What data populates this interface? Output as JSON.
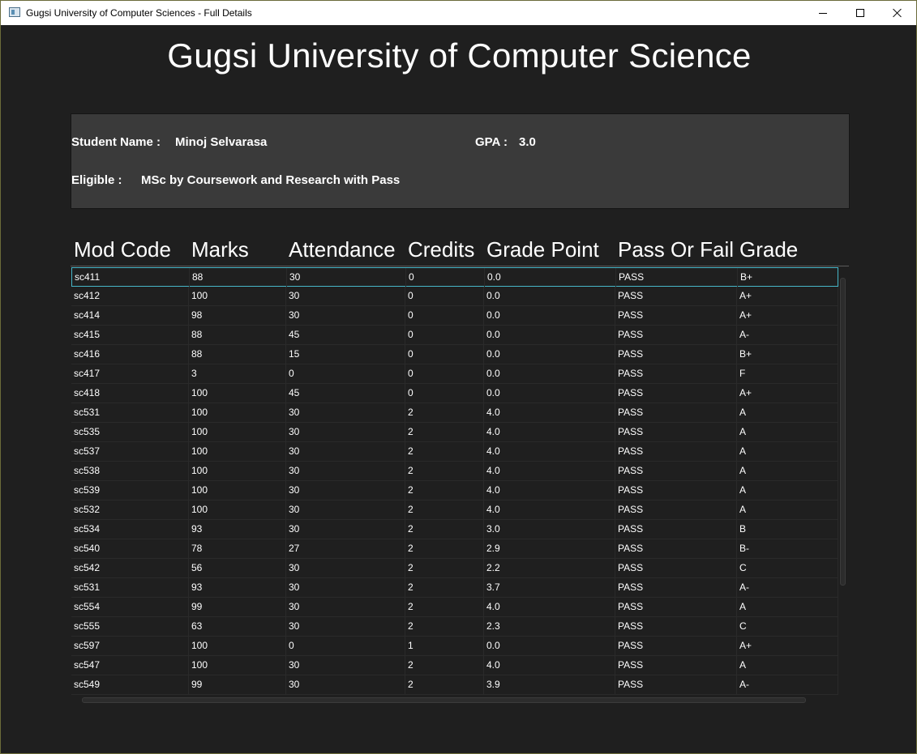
{
  "window": {
    "title": "Gugsi University of Computer Sciences - Full Details"
  },
  "heading": "Gugsi University of Computer Science",
  "student": {
    "name_label": "Student Name :",
    "name": "Minoj Selvarasa",
    "gpa_label": "GPA :",
    "gpa": "3.0",
    "eligible_label": "Eligible :",
    "eligible": "MSc by Coursework and Research with Pass"
  },
  "grid": {
    "columns": [
      "Mod Code",
      "Marks",
      "Attendance",
      "Credits",
      "Grade Point",
      "Pass Or Fail",
      "Grade"
    ],
    "rows": [
      [
        "sc411",
        "88",
        "30",
        "0",
        "0.0",
        "PASS",
        "B+"
      ],
      [
        "sc412",
        "100",
        "30",
        "0",
        "0.0",
        "PASS",
        "A+"
      ],
      [
        "sc414",
        "98",
        "30",
        "0",
        "0.0",
        "PASS",
        "A+"
      ],
      [
        "sc415",
        "88",
        "45",
        "0",
        "0.0",
        "PASS",
        "A-"
      ],
      [
        "sc416",
        "88",
        "15",
        "0",
        "0.0",
        "PASS",
        "B+"
      ],
      [
        "sc417",
        "3",
        "0",
        "0",
        "0.0",
        "PASS",
        "F"
      ],
      [
        "sc418",
        "100",
        "45",
        "0",
        "0.0",
        "PASS",
        "A+"
      ],
      [
        "sc531",
        "100",
        "30",
        "2",
        "4.0",
        "PASS",
        "A"
      ],
      [
        "sc535",
        "100",
        "30",
        "2",
        "4.0",
        "PASS",
        "A"
      ],
      [
        "sc537",
        "100",
        "30",
        "2",
        "4.0",
        "PASS",
        "A"
      ],
      [
        "sc538",
        "100",
        "30",
        "2",
        "4.0",
        "PASS",
        "A"
      ],
      [
        "sc539",
        "100",
        "30",
        "2",
        "4.0",
        "PASS",
        "A"
      ],
      [
        "sc532",
        "100",
        "30",
        "2",
        "4.0",
        "PASS",
        "A"
      ],
      [
        "sc534",
        "93",
        "30",
        "2",
        "3.0",
        "PASS",
        "B"
      ],
      [
        "sc540",
        "78",
        "27",
        "2",
        "2.9",
        "PASS",
        "B-"
      ],
      [
        "sc542",
        "56",
        "30",
        "2",
        "2.2",
        "PASS",
        "C"
      ],
      [
        "sc531",
        "93",
        "30",
        "2",
        "3.7",
        "PASS",
        "A-"
      ],
      [
        "sc554",
        "99",
        "30",
        "2",
        "4.0",
        "PASS",
        "A"
      ],
      [
        "sc555",
        "63",
        "30",
        "2",
        "2.3",
        "PASS",
        "C"
      ],
      [
        "sc597",
        "100",
        "0",
        "1",
        "0.0",
        "PASS",
        "A+"
      ],
      [
        "sc547",
        "100",
        "30",
        "2",
        "4.0",
        "PASS",
        "A"
      ],
      [
        "sc549",
        "99",
        "30",
        "2",
        "3.9",
        "PASS",
        "A-"
      ]
    ],
    "selected_row": 0
  },
  "colors": {
    "background": "#1f1f1f",
    "panel": "#3a3a3a",
    "selection_border": "#46b6c8",
    "text": "#ffffff"
  }
}
